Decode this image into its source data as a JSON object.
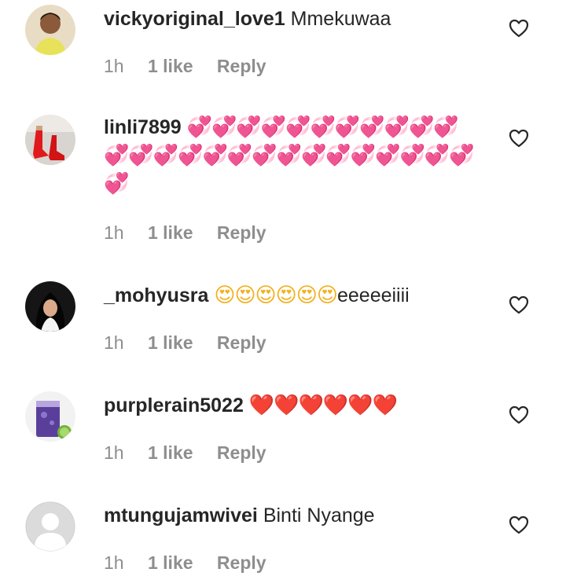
{
  "comments": [
    {
      "username": "vickyoriginal_love1",
      "text": "Mmekuwaa",
      "emoji": "",
      "emoji_tail": "",
      "time": "1h",
      "likes": "1 like",
      "reply": "Reply",
      "avatar": "photo-woman"
    },
    {
      "username": "linli7899",
      "text": "",
      "emoji": "💞💞💞💞💞💞💞💞💞💞💞💞💞💞💞💞💞💞💞💞💞💞💞💞💞💞💞",
      "emoji_tail": "",
      "time": "1h",
      "likes": "1 like",
      "reply": "Reply",
      "avatar": "photo-red-shoes"
    },
    {
      "username": "_mohyusra",
      "text": "",
      "emoji": "😍😍😍😍😍😍",
      "emoji_tail": "eeeeeiiii",
      "time": "1h",
      "likes": "1 like",
      "reply": "Reply",
      "avatar": "photo-woman-hijab"
    },
    {
      "username": "purplerain5022",
      "text": "",
      "emoji": "❤️❤️❤️❤️❤️❤️",
      "emoji_tail": "",
      "time": "1h",
      "likes": "1 like",
      "reply": "Reply",
      "avatar": "photo-purple-drink"
    },
    {
      "username": "mtungujamwivei",
      "text": "Binti Nyange",
      "emoji": "",
      "emoji_tail": "",
      "time": "1h",
      "likes": "1 like",
      "reply": "Reply",
      "avatar": "default-avatar"
    }
  ],
  "colors": {
    "text": "#262626",
    "meta": "#8e8e8e",
    "pink_heart": "#f25ea6",
    "red_heart": "#e0192b"
  },
  "icons": {
    "like": "heart-outline-icon"
  }
}
